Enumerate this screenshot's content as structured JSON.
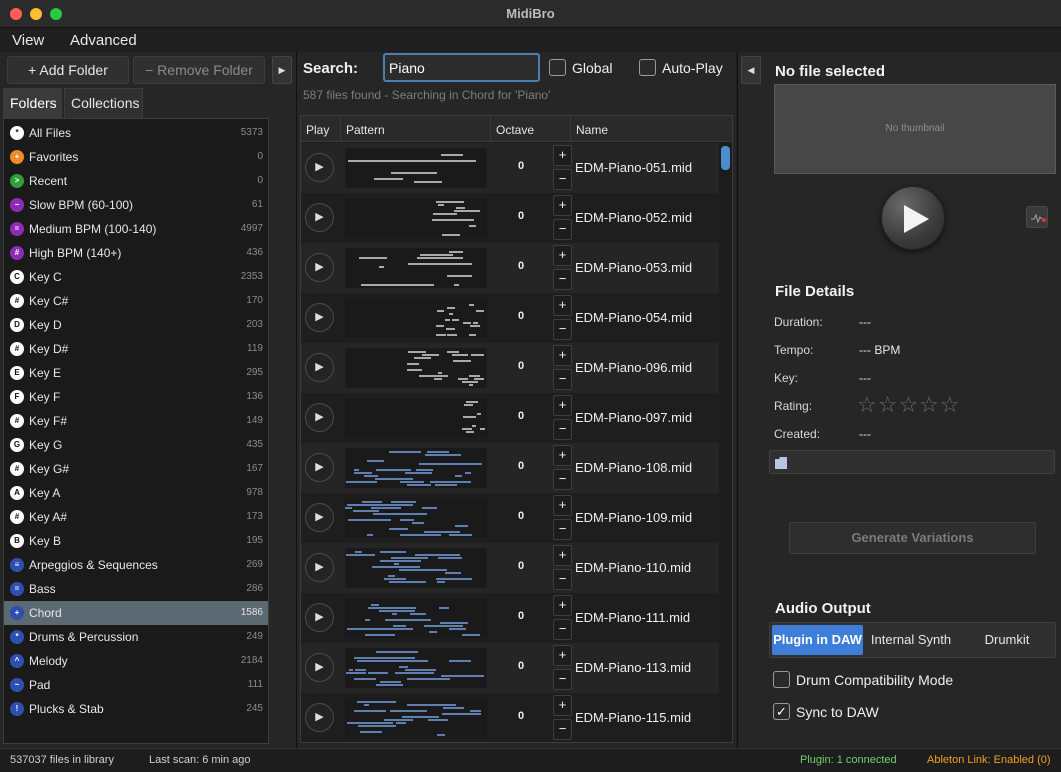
{
  "window": {
    "title": "MidiBro"
  },
  "menu": [
    "View",
    "Advanced"
  ],
  "left": {
    "add_folder": "+ Add Folder",
    "remove_folder": "− Remove Folder",
    "collapse": "▶",
    "tabs": [
      "Folders",
      "Collections"
    ],
    "folders": [
      {
        "badge": "*",
        "color": "#ffffff",
        "label": "All Files",
        "count": "5373"
      },
      {
        "badge": "+",
        "color": "#f08a24",
        "label": "Favorites",
        "count": "0"
      },
      {
        "badge": ">",
        "color": "#2e9d3a",
        "label": "Recent",
        "count": "0"
      },
      {
        "badge": "−",
        "color": "#8e2bb5",
        "label": "Slow BPM (60-100)",
        "count": "61"
      },
      {
        "badge": "=",
        "color": "#8e2bb5",
        "label": "Medium BPM (100-140)",
        "count": "4997"
      },
      {
        "badge": "#",
        "color": "#8e2bb5",
        "label": "High BPM (140+)",
        "count": "436"
      },
      {
        "badge": "C",
        "color": "#ffffff",
        "label": "Key C",
        "count": "2353"
      },
      {
        "badge": "#",
        "color": "#ffffff",
        "label": "Key C#",
        "count": "170"
      },
      {
        "badge": "D",
        "color": "#ffffff",
        "label": "Key D",
        "count": "203"
      },
      {
        "badge": "#",
        "color": "#ffffff",
        "label": "Key D#",
        "count": "119"
      },
      {
        "badge": "E",
        "color": "#ffffff",
        "label": "Key E",
        "count": "295"
      },
      {
        "badge": "F",
        "color": "#ffffff",
        "label": "Key F",
        "count": "136"
      },
      {
        "badge": "#",
        "color": "#ffffff",
        "label": "Key F#",
        "count": "149"
      },
      {
        "badge": "G",
        "color": "#ffffff",
        "label": "Key G",
        "count": "435"
      },
      {
        "badge": "#",
        "color": "#ffffff",
        "label": "Key G#",
        "count": "167"
      },
      {
        "badge": "A",
        "color": "#ffffff",
        "label": "Key A",
        "count": "978"
      },
      {
        "badge": "#",
        "color": "#ffffff",
        "label": "Key A#",
        "count": "173"
      },
      {
        "badge": "B",
        "color": "#ffffff",
        "label": "Key B",
        "count": "195"
      },
      {
        "badge": "≡",
        "color": "#2f4fb0",
        "label": "Arpeggios & Sequences",
        "count": "269"
      },
      {
        "badge": "=",
        "color": "#2f4fb0",
        "label": "Bass",
        "count": "286"
      },
      {
        "badge": "+",
        "color": "#2f4fb0",
        "label": "Chord",
        "count": "1586",
        "selected": true
      },
      {
        "badge": "*",
        "color": "#2f4fb0",
        "label": "Drums & Percussion",
        "count": "249"
      },
      {
        "badge": "^",
        "color": "#2f4fb0",
        "label": "Melody",
        "count": "2184"
      },
      {
        "badge": "~",
        "color": "#2f4fb0",
        "label": "Pad",
        "count": "111"
      },
      {
        "badge": "!",
        "color": "#2f4fb0",
        "label": "Plucks & Stab",
        "count": "245"
      }
    ]
  },
  "search": {
    "label": "Search:",
    "value": "Piano",
    "global_label": "Global",
    "autoplay_label": "Auto-Play",
    "status": "587 files found - Searching in Chord for 'Piano'"
  },
  "table": {
    "headers": [
      "Play",
      "Pattern",
      "Octave",
      "Name"
    ],
    "rows": [
      {
        "octave": "0",
        "name": "EDM-Piano-051.mid",
        "style": "gray-wide"
      },
      {
        "octave": "0",
        "name": "EDM-Piano-052.mid",
        "style": "gray-right"
      },
      {
        "octave": "0",
        "name": "EDM-Piano-053.mid",
        "style": "gray-wide"
      },
      {
        "octave": "0",
        "name": "EDM-Piano-054.mid",
        "style": "gray-dots"
      },
      {
        "octave": "0",
        "name": "EDM-Piano-096.mid",
        "style": "gray-dense"
      },
      {
        "octave": "0",
        "name": "EDM-Piano-097.mid",
        "style": "gray-sparse"
      },
      {
        "octave": "0",
        "name": "EDM-Piano-108.mid",
        "style": "blue"
      },
      {
        "octave": "0",
        "name": "EDM-Piano-109.mid",
        "style": "blue"
      },
      {
        "octave": "0",
        "name": "EDM-Piano-110.mid",
        "style": "blue"
      },
      {
        "octave": "0",
        "name": "EDM-Piano-111.mid",
        "style": "blue"
      },
      {
        "octave": "0",
        "name": "EDM-Piano-113.mid",
        "style": "blue"
      },
      {
        "octave": "0",
        "name": "EDM-Piano-115.mid",
        "style": "blue"
      }
    ],
    "play_glyph": "▶",
    "plus": "+",
    "minus": "−"
  },
  "right": {
    "collapse": "◀",
    "title": "No file selected",
    "thumbnail_text": "No thumbnail",
    "details_title": "File Details",
    "details": [
      {
        "label": "Duration:",
        "value": "---"
      },
      {
        "label": "Tempo:",
        "value": "--- BPM"
      },
      {
        "label": "Key:",
        "value": "---"
      },
      {
        "label": "Rating:",
        "value": ""
      },
      {
        "label": "Created:",
        "value": "---"
      }
    ],
    "stars": "☆☆☆☆☆",
    "generate": "Generate Variations",
    "audio_title": "Audio Output",
    "audio_options": [
      "Plugin in DAW",
      "Internal Synth",
      "Drumkit"
    ],
    "drum_compat": "Drum Compatibility Mode",
    "sync_daw": "Sync to DAW",
    "check_mark": "✓"
  },
  "status": {
    "files": "537037 files in library",
    "scan": "Last scan: 6 min ago",
    "plugin": "Plugin: 1 connected",
    "ableton": "Ableton Link: Enabled (0)"
  },
  "colors": {
    "accent": "#3e7ed8",
    "plugin_status": "#6fd36f",
    "ableton_status": "#f0a020"
  }
}
